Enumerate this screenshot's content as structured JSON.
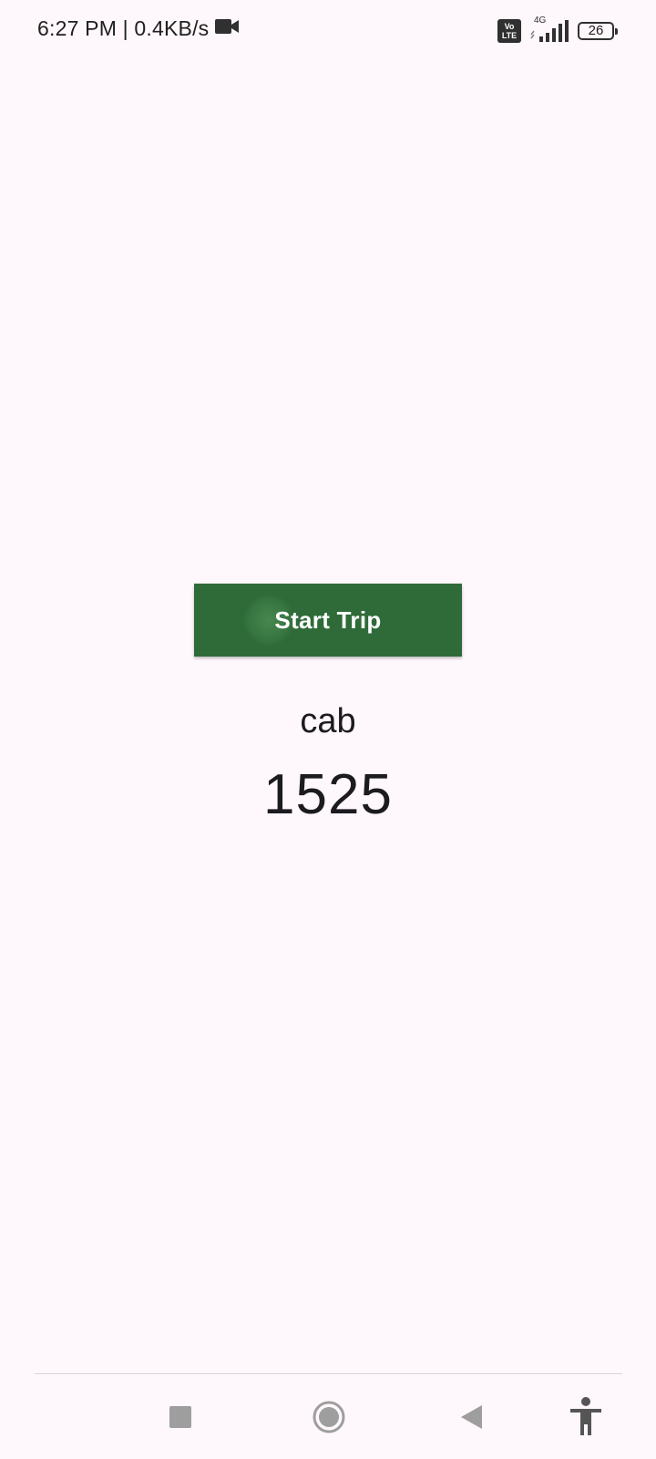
{
  "status_bar": {
    "time_speed": "6:27 PM | 0.4KB/s",
    "volte_line1": "Vo",
    "volte_line2": "LTE",
    "network_type": "4G",
    "battery_level": "26"
  },
  "main": {
    "start_button_label": "Start Trip",
    "vehicle_type": "cab",
    "trip_number": "1525"
  },
  "colors": {
    "background": "#fef7fb",
    "button": "#2e6b39",
    "text": "#1c1b1f"
  },
  "icons": {
    "recording": "video-camera-icon",
    "recents": "square-icon",
    "home": "circle-icon",
    "back": "triangle-back-icon",
    "accessibility": "accessibility-person-icon"
  }
}
